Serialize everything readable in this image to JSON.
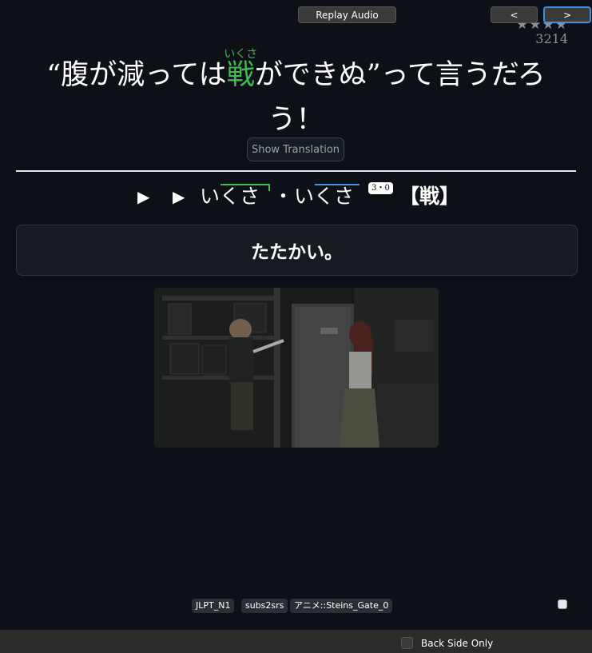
{
  "card": {
    "stars": "★★★★",
    "frequency": "3214",
    "sentence": {
      "before": "“腹が減っては",
      "target": "戦",
      "target_reading": "いくさ",
      "after": "ができぬ”って言うだろう！"
    },
    "show_translation_label": "Show Translation",
    "reading_row": {
      "play1": "▶",
      "play2": "▶",
      "reading1": "いくさ",
      "separator": "・",
      "reading2": "いくさ",
      "accent_badge": "3・0",
      "kanji": "【戦】"
    },
    "definition": "たたかい。",
    "tags": [
      "JLPT_N1",
      "subs2srs",
      "アニメ::Steins_Gate_0"
    ]
  },
  "colors": {
    "background": "#0d1117",
    "highlight_green": "#3fb950",
    "pitch_blue": "#4a90e2"
  },
  "bottom_bar": {
    "replay_audio": "Replay Audio",
    "back_side_only": "Back Side Only",
    "prev": "<",
    "next": ">"
  }
}
